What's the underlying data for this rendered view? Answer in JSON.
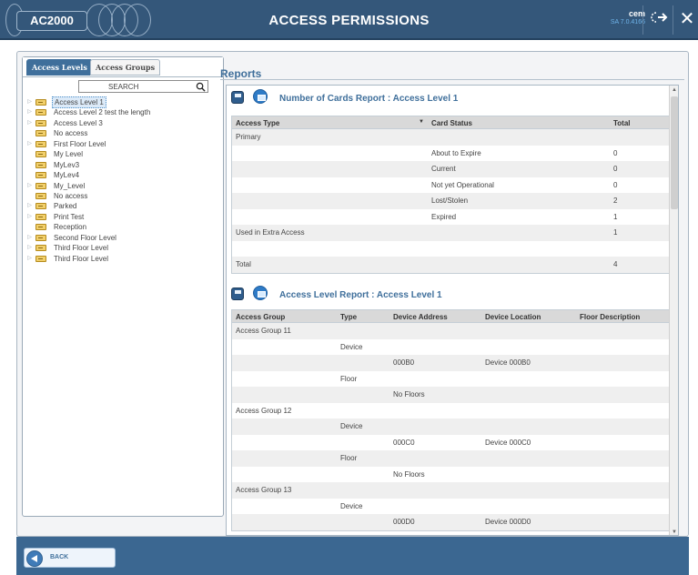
{
  "header": {
    "logo": "AC2000",
    "title": "ACCESS PERMISSIONS",
    "user": "cem",
    "version": "SA 7.0.4166"
  },
  "left_panel": {
    "tabs": [
      {
        "label": "Access Levels",
        "active": true
      },
      {
        "label": "Access Groups",
        "active": false
      }
    ],
    "search": {
      "placeholder": "SEARCH"
    },
    "tree": [
      {
        "label": "Access Level 1",
        "expandable": true,
        "selected": true
      },
      {
        "label": "Access Level 2 test the length",
        "expandable": true
      },
      {
        "label": "Access Level 3",
        "expandable": true
      },
      {
        "label": "No access",
        "expandable": false
      },
      {
        "label": "First Floor Level",
        "expandable": true
      },
      {
        "label": "My Level",
        "expandable": false
      },
      {
        "label": "MyLev3",
        "expandable": false
      },
      {
        "label": "MyLev4",
        "expandable": false
      },
      {
        "label": "My_Level",
        "expandable": true
      },
      {
        "label": "No access",
        "expandable": false
      },
      {
        "label": "Parked",
        "expandable": true
      },
      {
        "label": "Print Test",
        "expandable": true
      },
      {
        "label": "Reception",
        "expandable": false
      },
      {
        "label": "Second Floor Level",
        "expandable": true
      },
      {
        "label": "Third Floor Level",
        "expandable": true
      },
      {
        "label": "Third Floor Level",
        "expandable": true
      }
    ]
  },
  "reports": {
    "panel_title": "Reports",
    "cards_report": {
      "title": "Number of Cards Report : Access Level 1",
      "headers": [
        "Access Type",
        "Card Status",
        "Total"
      ],
      "rows": [
        [
          "Primary",
          "",
          ""
        ],
        [
          "",
          "About to Expire",
          "0"
        ],
        [
          "",
          "Current",
          "0"
        ],
        [
          "",
          "Not yet Operational",
          "0"
        ],
        [
          "",
          "Lost/Stolen",
          "2"
        ],
        [
          "",
          "Expired",
          "1"
        ],
        [
          "Used in Extra Access",
          "",
          "1"
        ],
        [
          "",
          "",
          ""
        ],
        [
          "Total",
          "",
          "4"
        ]
      ]
    },
    "level_report": {
      "title": "Access Level Report : Access Level 1",
      "headers": [
        "Access Group",
        "Type",
        "Device Address",
        "Device Location",
        "Floor Description"
      ],
      "rows": [
        [
          "Access Group 11",
          "",
          "",
          "",
          ""
        ],
        [
          "",
          "Device",
          "",
          "",
          ""
        ],
        [
          "",
          "",
          "000B0",
          "Device 000B0",
          ""
        ],
        [
          "",
          "Floor",
          "",
          "",
          ""
        ],
        [
          "",
          "",
          "No Floors",
          "",
          ""
        ],
        [
          "Access Group 12",
          "",
          "",
          "",
          ""
        ],
        [
          "",
          "Device",
          "",
          "",
          ""
        ],
        [
          "",
          "",
          "000C0",
          "Device 000C0",
          ""
        ],
        [
          "",
          "Floor",
          "",
          "",
          ""
        ],
        [
          "",
          "",
          "No Floors",
          "",
          ""
        ],
        [
          "Access Group 13",
          "",
          "",
          "",
          ""
        ],
        [
          "",
          "Device",
          "",
          "",
          ""
        ],
        [
          "",
          "",
          "000D0",
          "Device 000D0",
          ""
        ]
      ]
    }
  },
  "footer": {
    "back_label": "BACK"
  }
}
